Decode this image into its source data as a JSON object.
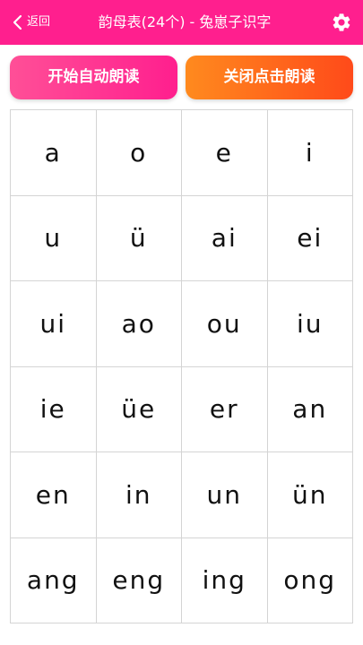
{
  "header": {
    "back_label": "返回",
    "title": "韵母表(24个) - 兔崽子识字"
  },
  "buttons": {
    "auto_read": "开始自动朗读",
    "click_read": "关闭点击朗读"
  },
  "colors": {
    "header_bg": "#ff1f8e",
    "auto_button": "#ff1f8e",
    "click_button": "#ff5a1a"
  },
  "icons": {
    "back": "chevron-left-icon",
    "settings": "gear-icon"
  },
  "finals": [
    "a",
    "o",
    "e",
    "i",
    "u",
    "ü",
    "ai",
    "ei",
    "ui",
    "ao",
    "ou",
    "iu",
    "ie",
    "üe",
    "er",
    "an",
    "en",
    "in",
    "un",
    "ün",
    "ang",
    "eng",
    "ing",
    "ong"
  ]
}
